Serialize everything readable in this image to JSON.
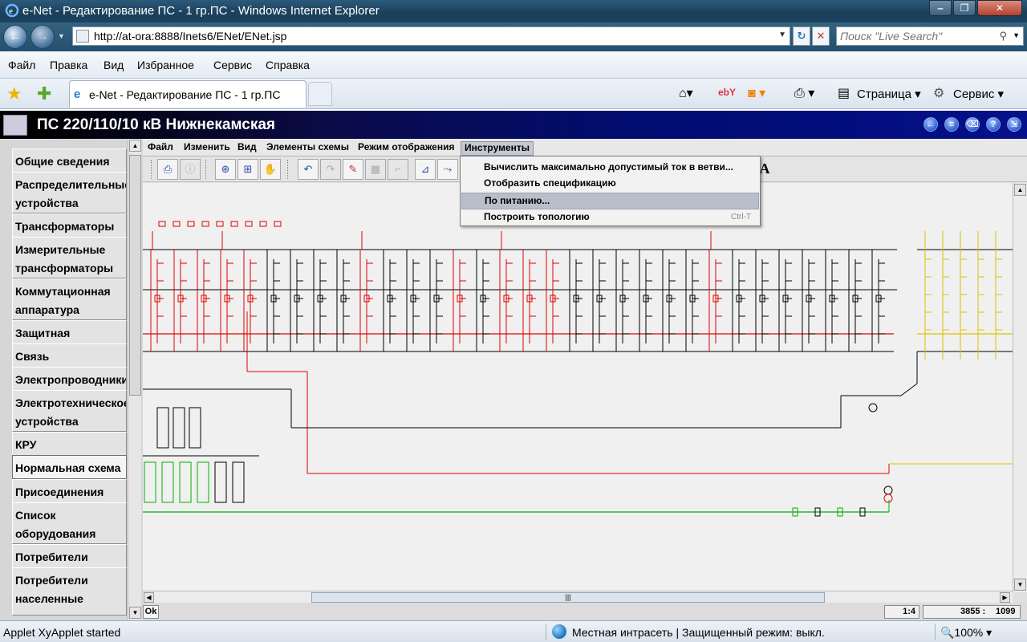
{
  "window": {
    "title": "e-Net - Редактирование ПС - 1 гр.ПС - Windows Internet Explorer",
    "min": "‒",
    "max": "❐",
    "close": "✕"
  },
  "address": {
    "url": "http://at-ora:8888/Inets6/ENet/ENet.jsp",
    "search_placeholder": "Поиск \"Live Search\""
  },
  "ie_menu": [
    "Файл",
    "Правка",
    "Вид",
    "Избранное",
    "Сервис",
    "Справка"
  ],
  "tab": {
    "label": "e-Net - Редактирование ПС - 1 гр.ПС"
  },
  "ie_toolbar": {
    "page": "Страница ▾",
    "service": "Сервис ▾"
  },
  "app": {
    "title": "ПС 220/110/10 кВ Нижнекамская"
  },
  "sidebar": {
    "items": [
      "Общие сведения",
      "Распределительные\nустройства",
      "Трансформаторы",
      "Измерительные\nтрансформаторы",
      "Коммутационная\nаппаратура",
      "Защитная аппаратура",
      "Связь",
      "Электропроводники",
      "Электротехническое\nустройства",
      "КРУ",
      "Нормальная схема",
      "Присоединения",
      "Список\nоборудования",
      "Потребители",
      "Потребители\nнаселенные пункты"
    ],
    "active_index": 10
  },
  "app_menu": [
    "Файл",
    "Изменить",
    "Вид",
    "Элементы схемы",
    "Режим отображения",
    "Инструменты"
  ],
  "dropdown": {
    "items": [
      {
        "label": "Вычислить максимально допустимый ток в ветви...",
        "shortcut": ""
      },
      {
        "label": "Отобразить спецификацию",
        "shortcut": ""
      },
      {
        "label": "По питанию...",
        "shortcut": ""
      },
      {
        "label": "Построить топологию",
        "shortcut": "Ctrl-T"
      }
    ],
    "highlighted_index": 2
  },
  "status": {
    "ok": "Ok",
    "scale": "1:4",
    "coord_x": "3855 :",
    "coord_y": "1099"
  },
  "ie_status": {
    "left": "Applet XyApplet started",
    "zone": "Местная интрасеть | Защищенный режим: выкл.",
    "zoom": "🔍100%  ▾"
  },
  "colors": {
    "red_line": "#e00000",
    "green_line": "#00b000",
    "yellow_line": "#e0c000",
    "black_line": "#000000"
  }
}
